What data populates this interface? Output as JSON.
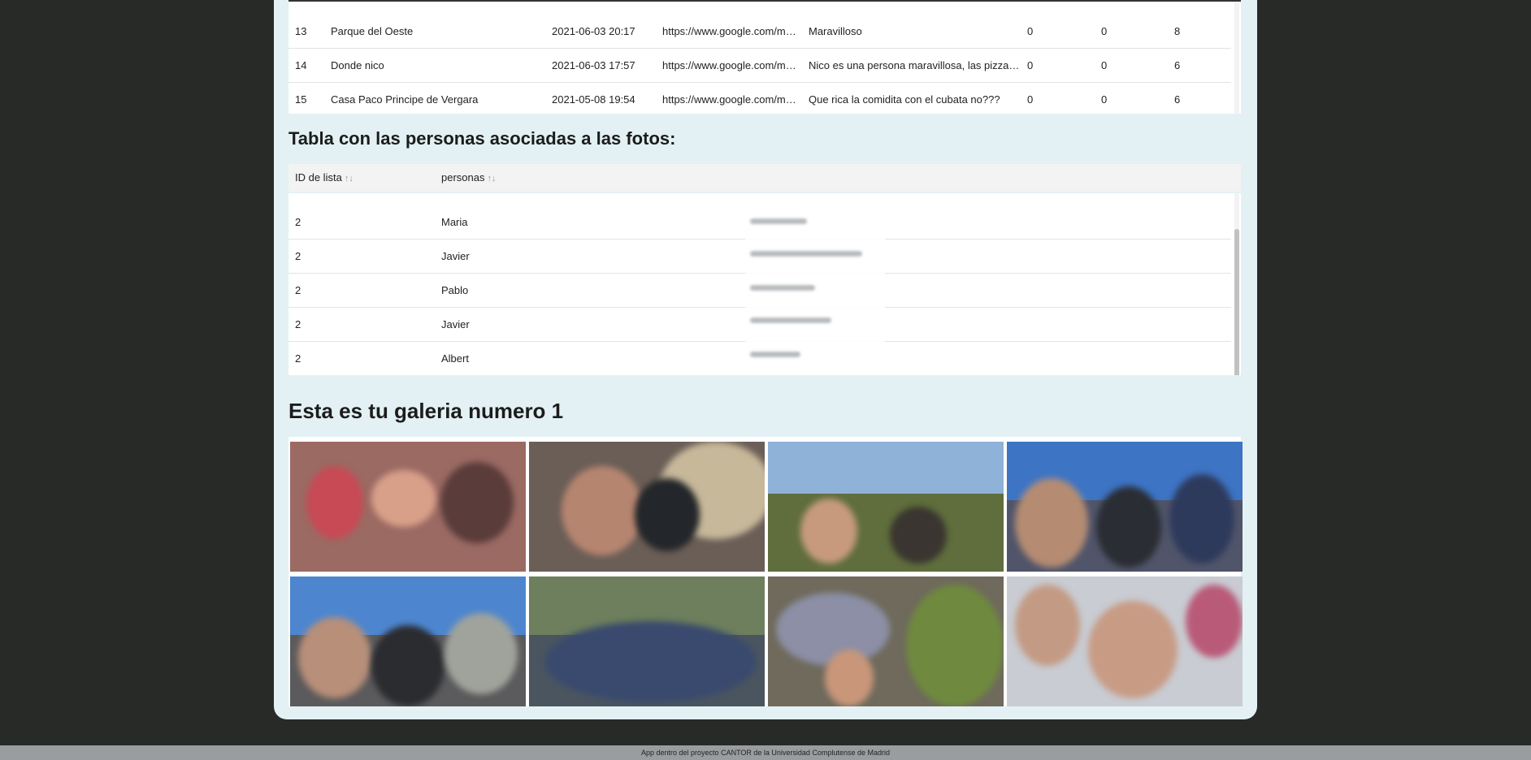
{
  "places_table": {
    "rows": [
      {
        "id": "13",
        "name": "Parque del Oeste",
        "date": "2021-06-03 20:17",
        "url": "https://www.google.com/ma...",
        "comment": "Maravilloso",
        "c1": "0",
        "c2": "0",
        "c3": "8"
      },
      {
        "id": "14",
        "name": "Donde nico",
        "date": "2021-06-03 17:57",
        "url": "https://www.google.com/ma...",
        "comment": "Nico es una persona maravillosa, las pizzas so...",
        "c1": "0",
        "c2": "0",
        "c3": "6"
      },
      {
        "id": "15",
        "name": "Casa Paco Principe de Vergara",
        "date": "2021-05-08 19:54",
        "url": "https://www.google.com/ma...",
        "comment": "Que rica la comidita con el cubata no???",
        "c1": "0",
        "c2": "0",
        "c3": "6"
      }
    ]
  },
  "persons_section": {
    "title": "Tabla con las personas asociadas a las fotos:",
    "columns": [
      "ID de lista",
      "personas"
    ],
    "sort_glyph": "↑↓",
    "rows": [
      {
        "id": "2",
        "person": "Maria"
      },
      {
        "id": "2",
        "person": "Javier"
      },
      {
        "id": "2",
        "person": "Pablo"
      },
      {
        "id": "2",
        "person": "Javier"
      },
      {
        "id": "2",
        "person": "Albert"
      }
    ]
  },
  "gallery": {
    "title": "Esta es tu galeria numero 1",
    "photo_count": 8
  },
  "footer": {
    "text": "App dentro del proyecto CANTOR de la Universidad Complutense de Madrid"
  },
  "colors": {
    "page_background": "#282a28",
    "panel_background": "#e3f1f4",
    "footer_background": "#9a9da0"
  }
}
